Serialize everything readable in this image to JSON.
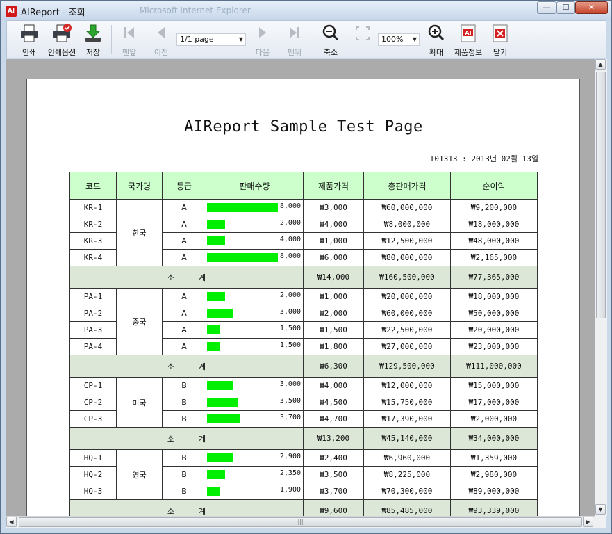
{
  "window": {
    "title": "AIReport - 조회",
    "ghost_title": "Microsoft Internet Explorer",
    "app_icon": "AI",
    "min_label": "—",
    "max_label": "☐",
    "close_label": "✕"
  },
  "toolbar": {
    "print": "인쇄",
    "print_options": "인쇄옵션",
    "save": "저장",
    "first": "맨앞",
    "prev": "이전",
    "page_select": "1/1 page",
    "next": "다음",
    "last": "맨뒤",
    "zoom_out": "축소",
    "zoom_value": "100%",
    "zoom_in": "확대",
    "product_info": "제품정보",
    "close": "닫기",
    "product_icon": "AI"
  },
  "report": {
    "title": "AIReport Sample Test Page",
    "date_line": "T01313 : 2013년 02월 13일",
    "headers": [
      "코드",
      "국가명",
      "등급",
      "판매수량",
      "제품가격",
      "총판매가격",
      "순이익"
    ],
    "subtotal_label": "소          계",
    "bar_max": 8000,
    "groups": [
      {
        "country": "한국",
        "rows": [
          {
            "code": "KR-1",
            "grade": "A",
            "qty": 8000,
            "qty_label": "8,000",
            "price": "₩3,000",
            "total": "₩60,000,000",
            "profit": "₩9,200,000"
          },
          {
            "code": "KR-2",
            "grade": "A",
            "qty": 2000,
            "qty_label": "2,000",
            "price": "₩4,000",
            "total": "₩8,000,000",
            "profit": "₩18,000,000"
          },
          {
            "code": "KR-3",
            "grade": "A",
            "qty": 2000,
            "qty_label": "4,000",
            "price": "₩1,000",
            "total": "₩12,500,000",
            "profit": "₩48,000,000"
          },
          {
            "code": "KR-4",
            "grade": "A",
            "qty": 8000,
            "qty_label": "8,000",
            "price": "₩6,000",
            "total": "₩80,000,000",
            "profit": "₩2,165,000"
          }
        ],
        "subtotal": {
          "price": "₩14,000",
          "total": "₩160,500,000",
          "profit": "₩77,365,000"
        }
      },
      {
        "country": "중국",
        "rows": [
          {
            "code": "PA-1",
            "grade": "A",
            "qty": 2000,
            "qty_label": "2,000",
            "price": "₩1,000",
            "total": "₩20,000,000",
            "profit": "₩18,000,000"
          },
          {
            "code": "PA-2",
            "grade": "A",
            "qty": 3000,
            "qty_label": "3,000",
            "price": "₩2,000",
            "total": "₩60,000,000",
            "profit": "₩50,000,000"
          },
          {
            "code": "PA-3",
            "grade": "A",
            "qty": 1500,
            "qty_label": "1,500",
            "price": "₩1,500",
            "total": "₩22,500,000",
            "profit": "₩20,000,000"
          },
          {
            "code": "PA-4",
            "grade": "A",
            "qty": 1500,
            "qty_label": "1,500",
            "price": "₩1,800",
            "total": "₩27,000,000",
            "profit": "₩23,000,000"
          }
        ],
        "subtotal": {
          "price": "₩6,300",
          "total": "₩129,500,000",
          "profit": "₩111,000,000"
        }
      },
      {
        "country": "미국",
        "rows": [
          {
            "code": "CP-1",
            "grade": "B",
            "qty": 3000,
            "qty_label": "3,000",
            "price": "₩4,000",
            "total": "₩12,000,000",
            "profit": "₩15,000,000"
          },
          {
            "code": "CP-2",
            "grade": "B",
            "qty": 3500,
            "qty_label": "3,500",
            "price": "₩4,500",
            "total": "₩15,750,000",
            "profit": "₩17,000,000"
          },
          {
            "code": "CP-3",
            "grade": "B",
            "qty": 3700,
            "qty_label": "3,700",
            "price": "₩4,700",
            "total": "₩17,390,000",
            "profit": "₩2,000,000"
          }
        ],
        "subtotal": {
          "price": "₩13,200",
          "total": "₩45,140,000",
          "profit": "₩34,000,000"
        }
      },
      {
        "country": "영국",
        "rows": [
          {
            "code": "HQ-1",
            "grade": "B",
            "qty": 2900,
            "qty_label": "2,900",
            "price": "₩2,400",
            "total": "₩6,960,000",
            "profit": "₩1,359,000"
          },
          {
            "code": "HQ-2",
            "grade": "B",
            "qty": 2000,
            "qty_label": "2,350",
            "price": "₩3,500",
            "total": "₩8,225,000",
            "profit": "₩2,980,000"
          },
          {
            "code": "HQ-3",
            "grade": "B",
            "qty": 1500,
            "qty_label": "1,900",
            "price": "₩3,700",
            "total": "₩70,300,000",
            "profit": "₩89,000,000"
          }
        ],
        "subtotal": {
          "price": "₩9,600",
          "total": "₩85,485,000",
          "profit": "₩93,339,000"
        }
      }
    ]
  },
  "colors": {
    "bar": "#00ee00",
    "header_bg": "#ccffcc",
    "subtotal_bg": "#dde7d7"
  }
}
